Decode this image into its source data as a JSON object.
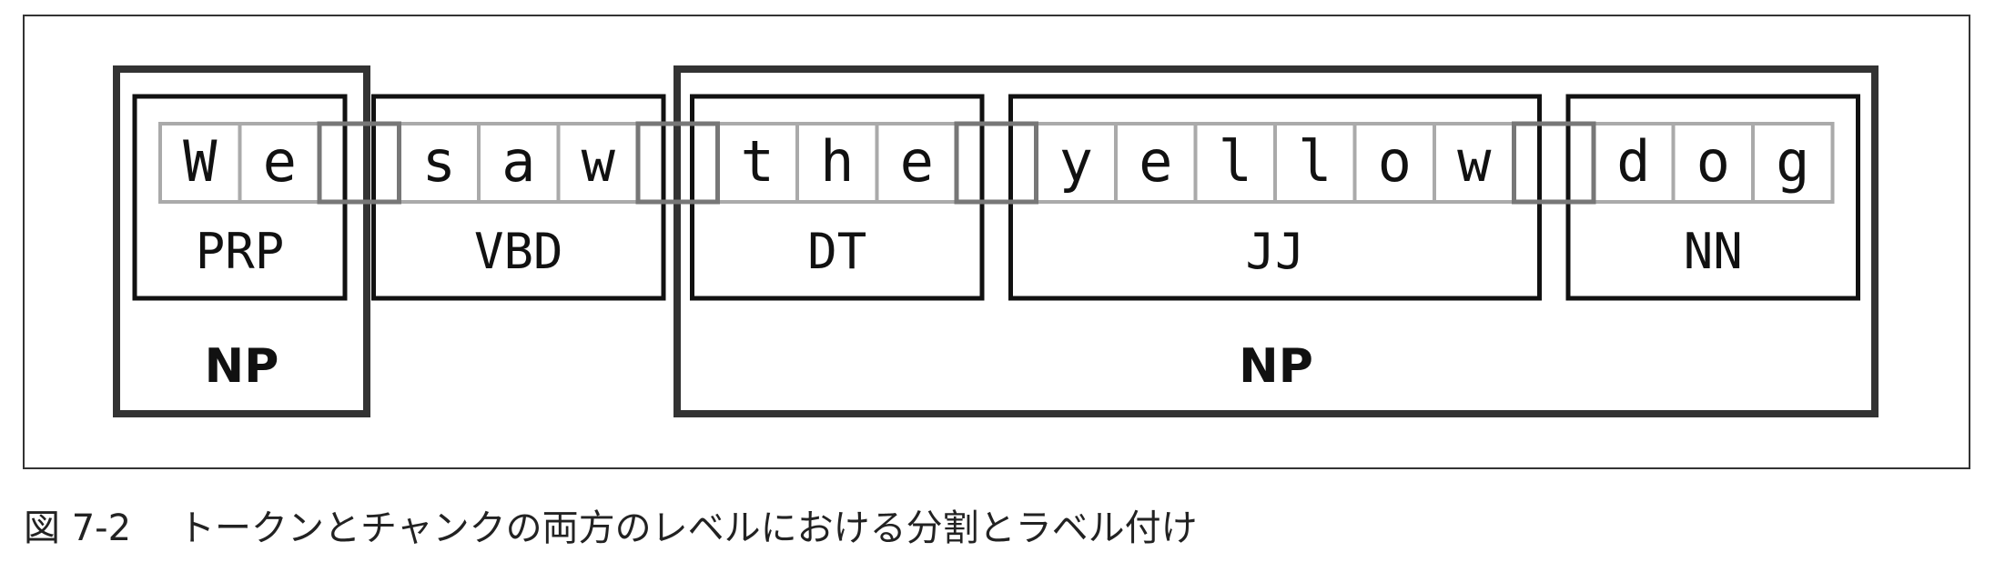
{
  "characters": [
    "W",
    "e",
    " ",
    "s",
    "a",
    "w",
    " ",
    "t",
    "h",
    "e",
    " ",
    "y",
    "e",
    "l",
    "l",
    "o",
    "w",
    " ",
    "d",
    "o",
    "g"
  ],
  "tokens": [
    {
      "tag": "PRP",
      "start": 0,
      "end": 2
    },
    {
      "tag": "VBD",
      "start": 3,
      "end": 6
    },
    {
      "tag": "DT",
      "start": 7,
      "end": 10
    },
    {
      "tag": "JJ",
      "start": 11,
      "end": 17
    },
    {
      "tag": "NN",
      "start": 18,
      "end": 21
    }
  ],
  "chunks": [
    {
      "label": "NP",
      "token_start": 0,
      "token_end": 1
    },
    {
      "label": "NP",
      "token_start": 2,
      "token_end": 5
    }
  ],
  "caption": {
    "number": "図 7-2",
    "text": "トークンとチャンクの両方のレベルにおける分割とラベル付け"
  }
}
